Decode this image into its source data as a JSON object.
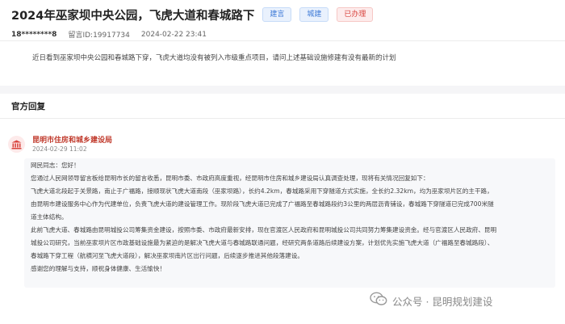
{
  "header": {
    "title": "2024年巫家坝中央公园，飞虎大道和春城路下",
    "tags": [
      {
        "label": "建言",
        "color": "#3a78d6"
      },
      {
        "label": "城建",
        "color": "#3a78d6"
      },
      {
        "label": "已办理",
        "color": "#d9453f"
      }
    ],
    "user": "18********8",
    "message_id": "留言ID:19917734",
    "posted_at": "2024-02-22 23:41"
  },
  "question": {
    "text": "近日看到巫家坝中央公园和春城路下穿，飞虎大道均没有被列入市级重点项目，请问上述基础设施修建有没有最新的计划"
  },
  "reply_section": {
    "title": "官方回复",
    "department": "昆明市住房和城乡建设局",
    "date": "2024-02-29 11:02",
    "icon": "government-building-icon",
    "lines": [
      "网民同志：您好！",
      "您通过人民网领导留言板给昆明市长的留言收悉，昆明市委、市政府高度重视，经昆明市住房和城乡建设局认真调查处理，现将有关情况回复如下：",
      "飞虎大道北段起于关景路，南止于广福路，接顺现状飞虎大道南段（巫家坝路），长约4.2km，春城路采用下穿隧道方式实施，全长约2.32km，均为巫家坝片区的主干路，",
      "由昆明市建设服务中心作为代建单位，负责飞虎大道的建设管理工作。现阶段飞虎大道已完成了广福路至春城路段约3公里的两层沥青铺设，春城路下穿隧道已完成700米隧",
      "道主体结构。",
      "此前飞虎大道、春城路由昆明城投公司筹集资金建设，按照市委、市政府最新安排，现在官渡区人民政府和昆明城投公司共同努力筹集建设资金。经与官渡区人民政府、昆明",
      "城投公司研究，当前巫家坝片区市政基础设施最为紧迫的是解决飞虎大道与春城路联通问题，经研究两条道路后续建设方案，计划优先实施飞虎大道（广福路至春城路段）、",
      "春城路下穿工程（航横河至飞虎大道段），解决巫家坝南片区出行问题，后续逐步推进其他段落建设。",
      "感谢您的理解与支持，顺祝身体健康、生活愉快！"
    ]
  },
  "watermark": {
    "text": "公众号 · 昆明规划建设",
    "icon": "wechat-icon"
  }
}
